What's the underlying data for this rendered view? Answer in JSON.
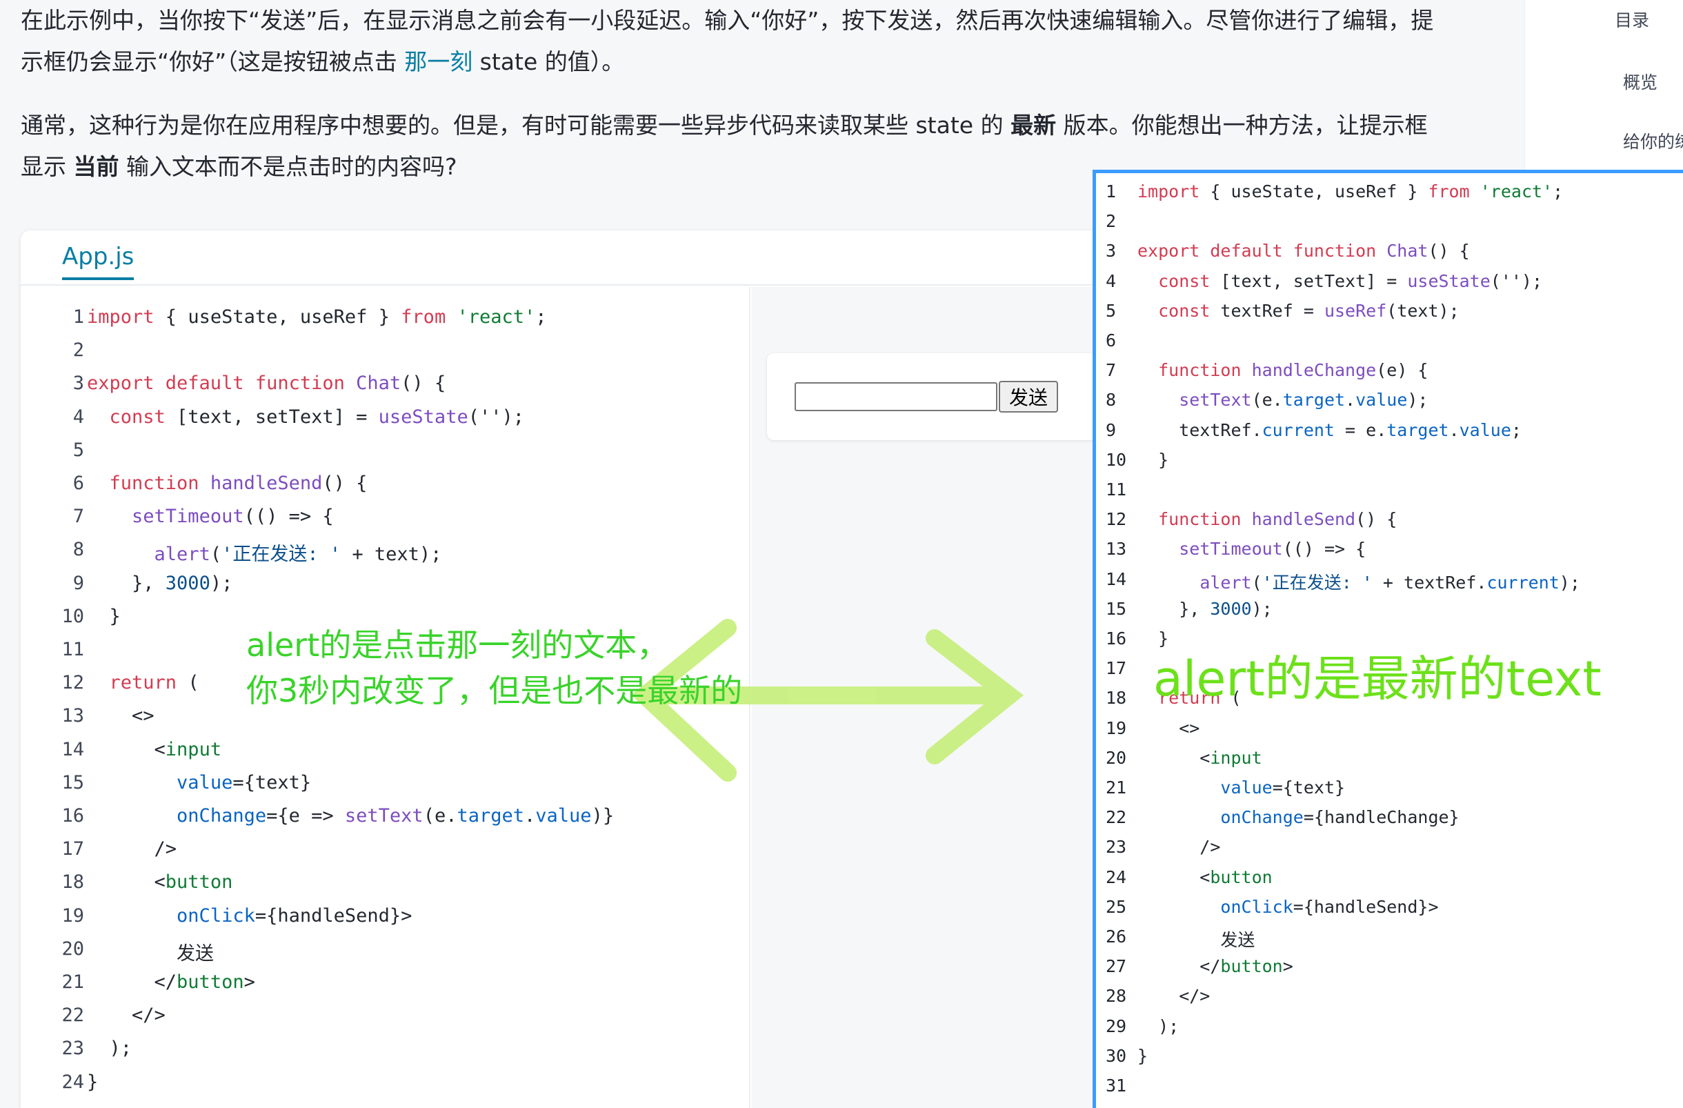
{
  "intro": {
    "line1": "在此示例中，当你按下“发送”后，在显示消息之前会有一小段延迟。输入“你好”，按下发送，然后再次快速编辑输入。尽管你进行了编辑，提",
    "line2_a": "示框仍会显示“你好”（这是按钮被点击 ",
    "line2_link": "那一刻",
    "line2_b": " state 的值）。",
    "p2_line1_a": "通常，这种行为是你在应用程序中想要的。但是，有时可能需要一些异步代码来读取某些 state 的 ",
    "p2_line1_bold": "最新",
    "p2_line1_b": " 版本。你能想出一种方法，让提示框",
    "p2_line2_a": "显示 ",
    "p2_line2_bold": "当前",
    "p2_line2_b": " 输入文本而不是点击时的内容吗?"
  },
  "toc": {
    "title": "目录",
    "item1": "概览",
    "item2": "给你的练"
  },
  "sandbox": {
    "tab": "App.js",
    "preview_button": "发送"
  },
  "left_code": {
    "line_numbers": [
      "1",
      "2",
      "3",
      "4",
      "5",
      "6",
      "7",
      "8",
      "9",
      "10",
      "11",
      "12",
      "13",
      "14",
      "15",
      "16",
      "17",
      "18",
      "19",
      "20",
      "21",
      "22",
      "23",
      "24"
    ],
    "lines": [
      [
        {
          "t": "import",
          "c": "k"
        },
        {
          "t": " { useState, useRef } "
        },
        {
          "t": "from",
          "c": "k"
        },
        {
          "t": " "
        },
        {
          "t": "'react'",
          "c": "s"
        },
        {
          "t": ";"
        }
      ],
      [],
      [
        {
          "t": "export default function",
          "c": "k"
        },
        {
          "t": " "
        },
        {
          "t": "Chat",
          "c": "f"
        },
        {
          "t": "() {"
        }
      ],
      [
        {
          "t": "  "
        },
        {
          "t": "const",
          "c": "k"
        },
        {
          "t": " [text, setText] = "
        },
        {
          "t": "useState",
          "c": "f"
        },
        {
          "t": "(''"
        },
        {
          "t": ");"
        }
      ],
      [],
      [
        {
          "t": "  "
        },
        {
          "t": "function",
          "c": "k"
        },
        {
          "t": " "
        },
        {
          "t": "handleSend",
          "c": "f"
        },
        {
          "t": "() {"
        }
      ],
      [
        {
          "t": "    "
        },
        {
          "t": "setTimeout",
          "c": "f"
        },
        {
          "t": "(() => {"
        }
      ],
      [
        {
          "t": "      "
        },
        {
          "t": "alert",
          "c": "f"
        },
        {
          "t": "("
        },
        {
          "t": "'正在发送: '",
          "c": "n"
        },
        {
          "t": " + text);"
        }
      ],
      [
        {
          "t": "    }, "
        },
        {
          "t": "3000",
          "c": "n"
        },
        {
          "t": ");"
        }
      ],
      [
        {
          "t": "  }"
        }
      ],
      [],
      [
        {
          "t": "  "
        },
        {
          "t": "return",
          "c": "k"
        },
        {
          "t": " ("
        }
      ],
      [
        {
          "t": "    <>"
        }
      ],
      [
        {
          "t": "      <"
        },
        {
          "t": "input",
          "c": "t"
        }
      ],
      [
        {
          "t": "        "
        },
        {
          "t": "value",
          "c": "p"
        },
        {
          "t": "={text}"
        }
      ],
      [
        {
          "t": "        "
        },
        {
          "t": "onChange",
          "c": "p"
        },
        {
          "t": "={e => "
        },
        {
          "t": "setText",
          "c": "f"
        },
        {
          "t": "(e."
        },
        {
          "t": "target",
          "c": "p"
        },
        {
          "t": "."
        },
        {
          "t": "value",
          "c": "p"
        },
        {
          "t": ")}"
        }
      ],
      [
        {
          "t": "      />"
        }
      ],
      [
        {
          "t": "      <"
        },
        {
          "t": "button",
          "c": "t"
        }
      ],
      [
        {
          "t": "        "
        },
        {
          "t": "onClick",
          "c": "p"
        },
        {
          "t": "={handleSend}>"
        }
      ],
      [
        {
          "t": "        发送"
        }
      ],
      [
        {
          "t": "      </"
        },
        {
          "t": "button",
          "c": "t"
        },
        {
          "t": ">"
        }
      ],
      [
        {
          "t": "    </>"
        }
      ],
      [
        {
          "t": "  );"
        }
      ],
      [
        {
          "t": "}"
        }
      ]
    ]
  },
  "right_code": {
    "line_numbers": [
      "1",
      "2",
      "3",
      "4",
      "5",
      "6",
      "7",
      "8",
      "9",
      "10",
      "11",
      "12",
      "13",
      "14",
      "15",
      "16",
      "17",
      "18",
      "19",
      "20",
      "21",
      "22",
      "23",
      "24",
      "25",
      "26",
      "27",
      "28",
      "29",
      "30",
      "31"
    ],
    "lines": [
      [
        {
          "t": "import",
          "c": "k"
        },
        {
          "t": " { useState, useRef } "
        },
        {
          "t": "from",
          "c": "k"
        },
        {
          "t": " "
        },
        {
          "t": "'react'",
          "c": "s"
        },
        {
          "t": ";"
        }
      ],
      [],
      [
        {
          "t": "export default function",
          "c": "k"
        },
        {
          "t": " "
        },
        {
          "t": "Chat",
          "c": "f"
        },
        {
          "t": "() {"
        }
      ],
      [
        {
          "t": "  "
        },
        {
          "t": "const",
          "c": "k"
        },
        {
          "t": " [text, setText] = "
        },
        {
          "t": "useState",
          "c": "f"
        },
        {
          "t": "('');"
        }
      ],
      [
        {
          "t": "  "
        },
        {
          "t": "const",
          "c": "k"
        },
        {
          "t": " textRef = "
        },
        {
          "t": "useRef",
          "c": "f"
        },
        {
          "t": "(text);"
        }
      ],
      [],
      [
        {
          "t": "  "
        },
        {
          "t": "function",
          "c": "k"
        },
        {
          "t": " "
        },
        {
          "t": "handleChange",
          "c": "f"
        },
        {
          "t": "(e) {"
        }
      ],
      [
        {
          "t": "    "
        },
        {
          "t": "setText",
          "c": "f"
        },
        {
          "t": "(e."
        },
        {
          "t": "target",
          "c": "p"
        },
        {
          "t": "."
        },
        {
          "t": "value",
          "c": "p"
        },
        {
          "t": ");"
        }
      ],
      [
        {
          "t": "    textRef."
        },
        {
          "t": "current",
          "c": "p"
        },
        {
          "t": " = e."
        },
        {
          "t": "target",
          "c": "p"
        },
        {
          "t": "."
        },
        {
          "t": "value",
          "c": "p"
        },
        {
          "t": ";"
        }
      ],
      [
        {
          "t": "  }"
        }
      ],
      [],
      [
        {
          "t": "  "
        },
        {
          "t": "function",
          "c": "k"
        },
        {
          "t": " "
        },
        {
          "t": "handleSend",
          "c": "f"
        },
        {
          "t": "() {"
        }
      ],
      [
        {
          "t": "    "
        },
        {
          "t": "setTimeout",
          "c": "f"
        },
        {
          "t": "(() => {"
        }
      ],
      [
        {
          "t": "      "
        },
        {
          "t": "alert",
          "c": "f"
        },
        {
          "t": "("
        },
        {
          "t": "'正在发送: '",
          "c": "n"
        },
        {
          "t": " + textRef."
        },
        {
          "t": "current",
          "c": "p"
        },
        {
          "t": ");"
        }
      ],
      [
        {
          "t": "    }, "
        },
        {
          "t": "3000",
          "c": "n"
        },
        {
          "t": ");"
        }
      ],
      [
        {
          "t": "  }"
        }
      ],
      [],
      [
        {
          "t": "  "
        },
        {
          "t": "return",
          "c": "k"
        },
        {
          "t": " ("
        }
      ],
      [
        {
          "t": "    <>"
        }
      ],
      [
        {
          "t": "      <"
        },
        {
          "t": "input",
          "c": "t"
        }
      ],
      [
        {
          "t": "        "
        },
        {
          "t": "value",
          "c": "p"
        },
        {
          "t": "={text}"
        }
      ],
      [
        {
          "t": "        "
        },
        {
          "t": "onChange",
          "c": "p"
        },
        {
          "t": "={handleChange}"
        }
      ],
      [
        {
          "t": "      />"
        }
      ],
      [
        {
          "t": "      <"
        },
        {
          "t": "button",
          "c": "t"
        }
      ],
      [
        {
          "t": "        "
        },
        {
          "t": "onClick",
          "c": "p"
        },
        {
          "t": "={handleSend}>"
        }
      ],
      [
        {
          "t": "        发送"
        }
      ],
      [
        {
          "t": "      </"
        },
        {
          "t": "button",
          "c": "t"
        },
        {
          "t": ">"
        }
      ],
      [
        {
          "t": "    </>"
        }
      ],
      [
        {
          "t": "  );"
        }
      ],
      [
        {
          "t": "}"
        }
      ],
      []
    ]
  },
  "annotations": {
    "left_line1": "alert的是点击那一刻的文本，",
    "left_line2": "你3秒内改变了，但是也不是最新的",
    "right": "alert的是最新的text"
  }
}
